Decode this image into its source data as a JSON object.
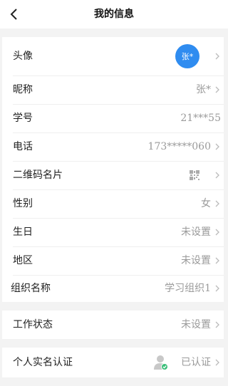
{
  "header": {
    "title": "我的信息",
    "back_icon": "chevron-left-icon"
  },
  "profile": {
    "avatar": {
      "label": "头像",
      "text": "张*",
      "color": "#2f8cf0"
    },
    "nickname": {
      "label": "昵称",
      "value": "张*"
    },
    "student_id": {
      "label": "学号",
      "value": "21***55"
    },
    "phone": {
      "label": "电话",
      "value": "173*****060"
    },
    "qr_card": {
      "label": "二维码名片",
      "icon": "qr-code-icon"
    },
    "gender": {
      "label": "性别",
      "value": "女"
    },
    "birthday": {
      "label": "生日",
      "value": "未设置"
    },
    "region": {
      "label": "地区",
      "value": "未设置"
    },
    "organization": {
      "label": "组织名称",
      "value": "学习组织1"
    }
  },
  "work_status": {
    "label": "工作状态",
    "value": "未设置"
  },
  "verification": {
    "label": "个人实名认证",
    "value": "已认证",
    "icon": "verified-user-icon"
  }
}
